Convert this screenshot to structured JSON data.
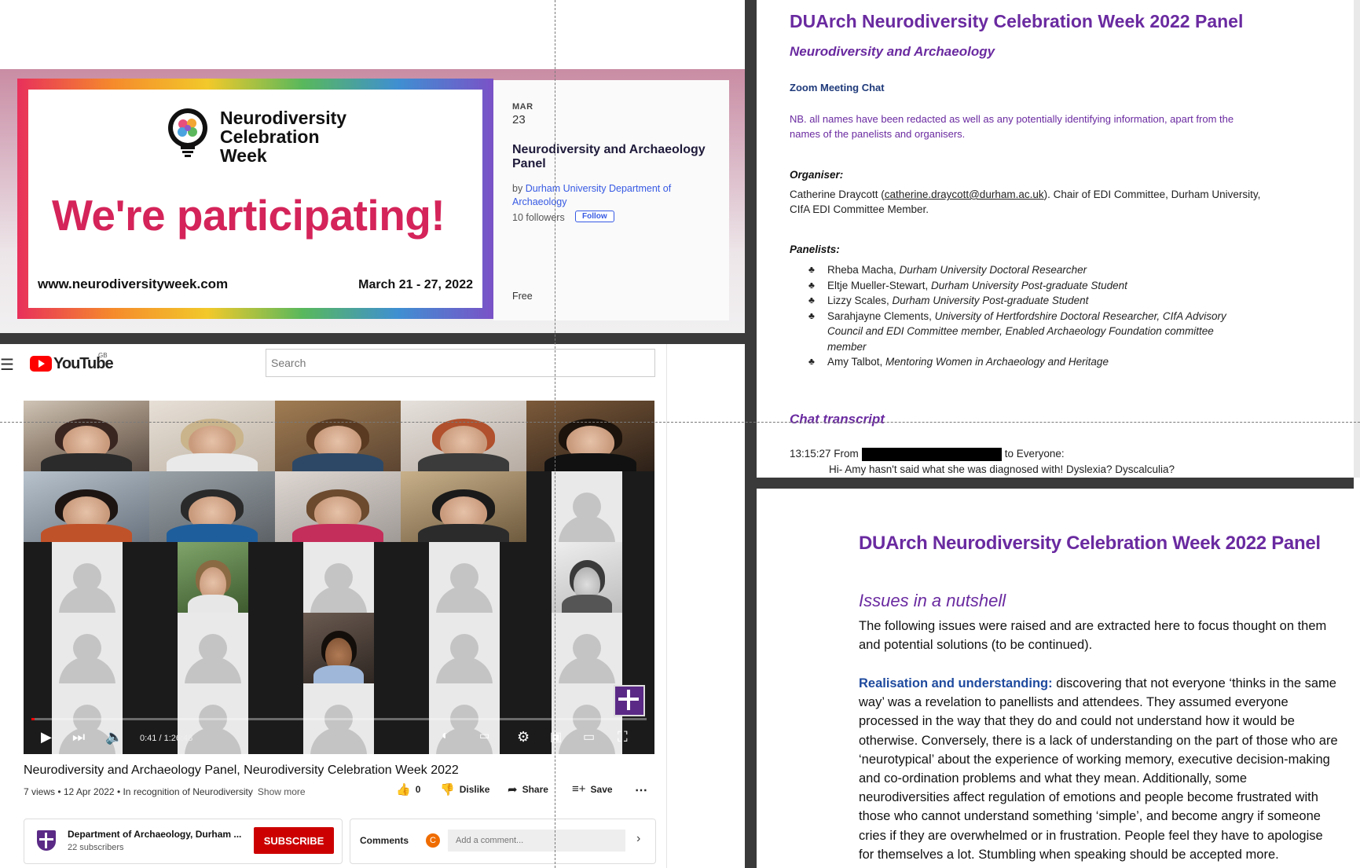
{
  "eventbrite": {
    "banner_logo_text": [
      "Neurodiversity",
      "Celebration",
      "Week"
    ],
    "headline": "We're participating!",
    "url": "www.neurodiversityweek.com",
    "dates": "March 21 - 27, 2022",
    "month": "MAR",
    "day": "23",
    "title": "Neurodiversity and Archaeology Panel",
    "organiser_prefix": "by ",
    "organiser": "Durham University Department of Archaeology",
    "followers": "10 followers",
    "follow_label": "Follow",
    "price": "Free"
  },
  "youtube": {
    "menu_icon": "hamburger-icon",
    "logo_text": "YouTube",
    "region": "GB",
    "search_placeholder": "Search",
    "progress_fraction": 0.0052,
    "time": "0:41 / 1:26:48",
    "title": "Neurodiversity and Archaeology Panel, Neurodiversity Celebration Week 2022",
    "meta": "7 views • 12 Apr 2022 • In recognition of Neurodiversity",
    "show_more": "Show more",
    "like_count": "0",
    "dislike_label": "Dislike",
    "share_label": "Share",
    "save_label": "Save",
    "channel_name": "Department of Archaeology, Durham ...",
    "subscribers": "22 subscribers",
    "subscribe_label": "SUBSCRIBE",
    "comments_label": "Comments",
    "comment_avatar_letter": "C",
    "comment_placeholder": "Add a comment...",
    "accent": "#ff0000"
  },
  "doc1": {
    "title": "DUArch Neurodiversity Celebration Week 2022 Panel",
    "subtitle": "Neurodiversity and Archaeology",
    "zoom_heading": "Zoom Meeting Chat",
    "nb": "NB. all names have been redacted as well as any potentially identifying information, apart from the names of the panelists and organisers.",
    "organiser_label": "Organiser:",
    "organiser_name": "Catherine Draycott (",
    "organiser_email": "catherine.draycott@durham.ac.uk",
    "organiser_rest": "). Chair of EDI Committee, Durham University, CIfA EDI Committee Member.",
    "panelists_label": "Panelists:",
    "panelists": [
      {
        "name": "Rheba Macha, ",
        "role": "Durham University Doctoral Researcher"
      },
      {
        "name": "Eltje Mueller-Stewart, ",
        "role": "Durham University Post-graduate Student"
      },
      {
        "name": "Lizzy Scales, ",
        "role": "Durham University Post-graduate Student"
      },
      {
        "name": "Sarahjayne Clements, ",
        "role": "University of Hertfordshire Doctoral Researcher, CIfA Advisory Council and EDI Committee member, Enabled Archaeology Foundation committee member"
      },
      {
        "name": "Amy Talbot, ",
        "role": "Mentoring Women in Archaeology and Heritage"
      }
    ],
    "chat_label": "Chat transcript",
    "chat_time": "13:15:27 From",
    "chat_to": "to Everyone:",
    "chat_message": "Hi- Amy hasn't said what she was diagnosed with! Dyslexia? Dyscalculia?",
    "title_color": "#6a2aa0"
  },
  "doc2": {
    "title": "DUArch Neurodiversity Celebration Week 2022 Panel",
    "heading": "Issues in a nutshell",
    "intro": "The following issues were raised and are extracted here to focus thought on them and potential solutions (to be continued).",
    "lead": "Realisation and understanding:",
    "body": " discovering that not everyone ‘thinks in the same way’ was a revelation to panellists and attendees. They assumed everyone processed in the way that they do and could not understand how it would be otherwise. Conversely, there is a lack of understanding on the part of those who are ‘neurotypical’ about the experience of working memory, executive decision-making and co-ordination problems and what they mean. Additionally, some neurodiversities affect regulation of emotions and people become frustrated with those who cannot understand something ‘simple’, and become angry if someone cries if they are overwhelmed or in frustration. People feel they have to apologise for themselves a lot. Stumbling when speaking should be accepted more."
  }
}
